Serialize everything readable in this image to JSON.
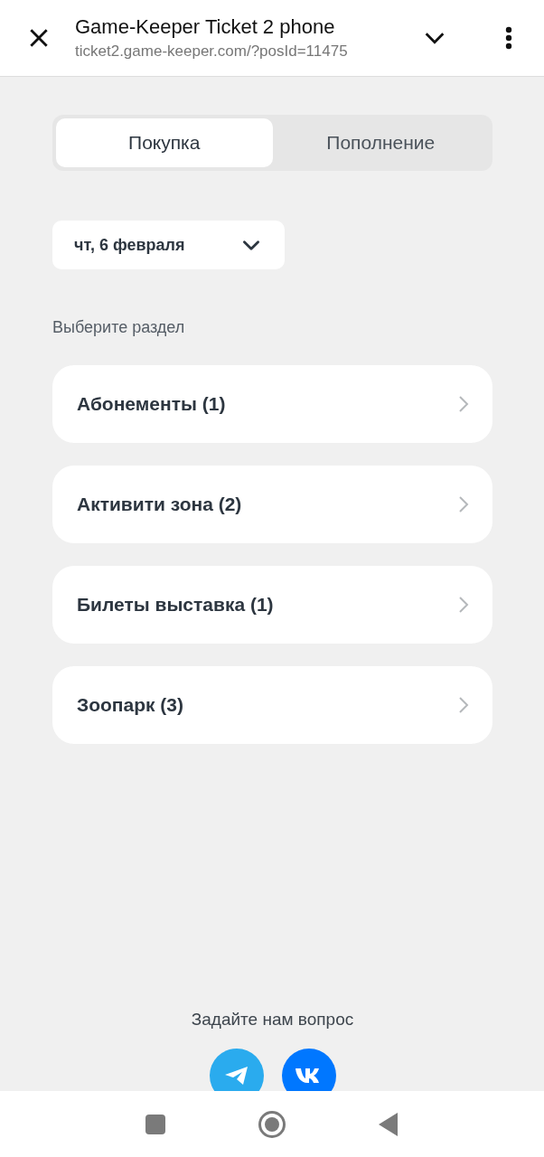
{
  "browser_bar": {
    "title": "Game-Keeper Ticket 2 phone",
    "url": "ticket2.game-keeper.com/?posId=11475"
  },
  "tabs": [
    {
      "label": "Покупка",
      "selected": true
    },
    {
      "label": "Пополнение",
      "selected": false
    }
  ],
  "date_select": {
    "value": "чт, 6 февраля"
  },
  "section_heading": "Выберите раздел",
  "sections": [
    {
      "label": "Абонементы (1)"
    },
    {
      "label": "Активити зона (2)"
    },
    {
      "label": "Билеты выставка (1)"
    },
    {
      "label": "Зоопарк (3)"
    }
  ],
  "contact": {
    "text": "Задайте нам вопрос",
    "links": [
      {
        "kind": "telegram",
        "color": "#2aabee"
      },
      {
        "kind": "vk",
        "color": "#0077ff"
      }
    ]
  }
}
